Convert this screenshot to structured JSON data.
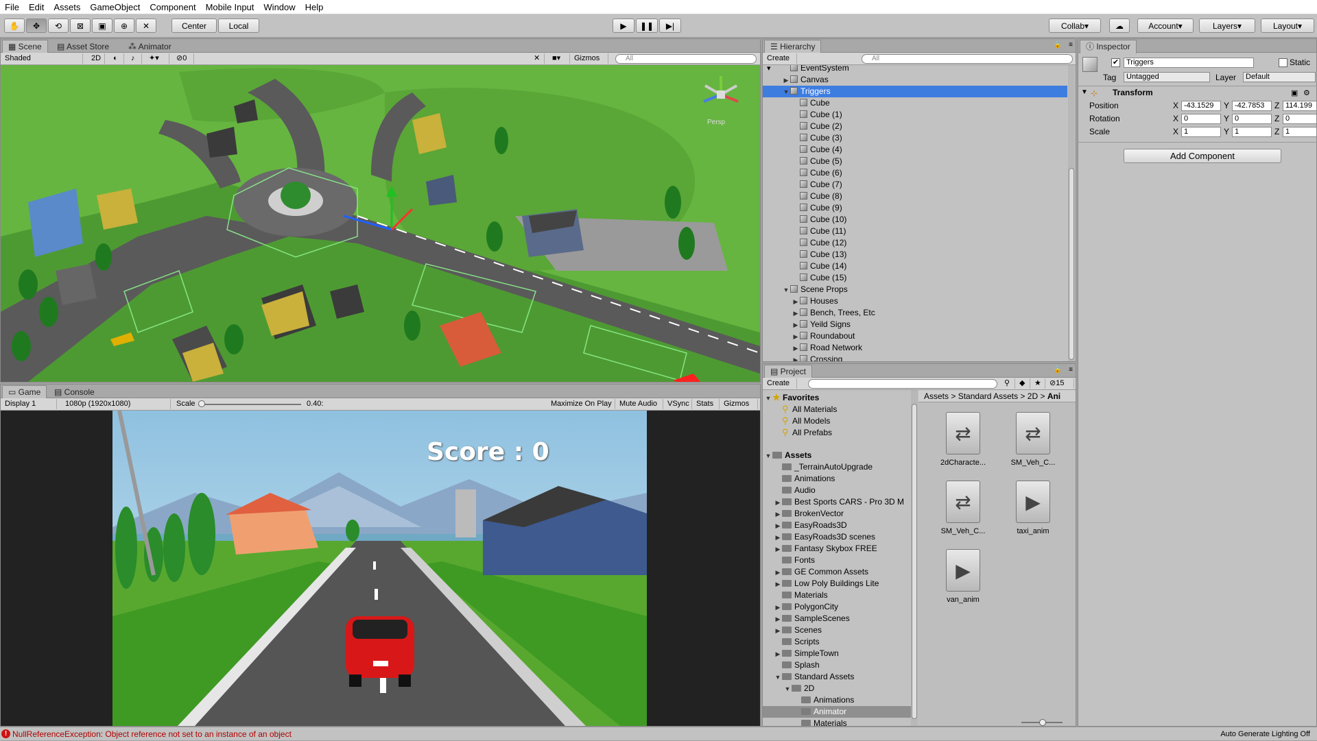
{
  "menu": [
    "File",
    "Edit",
    "Assets",
    "GameObject",
    "Component",
    "Mobile Input",
    "Window",
    "Help"
  ],
  "toolbar": {
    "center": "Center",
    "local": "Local",
    "collab": "Collab",
    "account": "Account",
    "layers": "Layers",
    "layout": "Layout"
  },
  "scene": {
    "tabs": [
      "Scene",
      "Asset Store",
      "Animator"
    ],
    "shading": "Shaded",
    "mode2d": "2D",
    "layers_count": "0",
    "gizmos": "Gizmos",
    "search": "All",
    "persp": "Persp"
  },
  "game": {
    "tabs": [
      "Game",
      "Console"
    ],
    "display": "Display 1",
    "resolution": "1080p (1920x1080)",
    "scale_label": "Scale",
    "scale_value": "0.40:",
    "options": [
      "Maximize On Play",
      "Mute Audio",
      "VSync",
      "Stats",
      "Gizmos"
    ],
    "score": "Score : 0"
  },
  "hierarchy": {
    "title": "Hierarchy",
    "create": "Create",
    "search": "All",
    "rows": [
      {
        "label": "EventSystem",
        "indent": 0,
        "arrow": "",
        "icon": "cube"
      },
      {
        "label": "Canvas",
        "indent": 0,
        "arrow": "▶",
        "icon": "cube"
      },
      {
        "label": "Triggers",
        "indent": 0,
        "arrow": "▼",
        "icon": "cube",
        "selected": true
      },
      {
        "label": "Cube",
        "indent": 1,
        "arrow": "",
        "icon": "cube"
      },
      {
        "label": "Cube (1)",
        "indent": 1,
        "arrow": "",
        "icon": "cube"
      },
      {
        "label": "Cube (2)",
        "indent": 1,
        "arrow": "",
        "icon": "cube"
      },
      {
        "label": "Cube (3)",
        "indent": 1,
        "arrow": "",
        "icon": "cube"
      },
      {
        "label": "Cube (4)",
        "indent": 1,
        "arrow": "",
        "icon": "cube"
      },
      {
        "label": "Cube (5)",
        "indent": 1,
        "arrow": "",
        "icon": "cube"
      },
      {
        "label": "Cube (6)",
        "indent": 1,
        "arrow": "",
        "icon": "cube"
      },
      {
        "label": "Cube (7)",
        "indent": 1,
        "arrow": "",
        "icon": "cube"
      },
      {
        "label": "Cube (8)",
        "indent": 1,
        "arrow": "",
        "icon": "cube"
      },
      {
        "label": "Cube (9)",
        "indent": 1,
        "arrow": "",
        "icon": "cube"
      },
      {
        "label": "Cube (10)",
        "indent": 1,
        "arrow": "",
        "icon": "cube"
      },
      {
        "label": "Cube (11)",
        "indent": 1,
        "arrow": "",
        "icon": "cube"
      },
      {
        "label": "Cube (12)",
        "indent": 1,
        "arrow": "",
        "icon": "cube"
      },
      {
        "label": "Cube (13)",
        "indent": 1,
        "arrow": "",
        "icon": "cube"
      },
      {
        "label": "Cube (14)",
        "indent": 1,
        "arrow": "",
        "icon": "cube"
      },
      {
        "label": "Cube (15)",
        "indent": 1,
        "arrow": "",
        "icon": "cube"
      },
      {
        "label": "Scene Props",
        "indent": 0,
        "arrow": "▼",
        "icon": "cube"
      },
      {
        "label": "Houses",
        "indent": 1,
        "arrow": "▶",
        "icon": "cube"
      },
      {
        "label": "Bench, Trees, Etc",
        "indent": 1,
        "arrow": "▶",
        "icon": "cube"
      },
      {
        "label": "Yeild Signs",
        "indent": 1,
        "arrow": "▶",
        "icon": "cube"
      },
      {
        "label": "Roundabout",
        "indent": 1,
        "arrow": "▶",
        "icon": "cube"
      },
      {
        "label": "Road Network",
        "indent": 1,
        "arrow": "▶",
        "icon": "cube"
      },
      {
        "label": "Crossing",
        "indent": 1,
        "arrow": "▶",
        "icon": "cube"
      }
    ]
  },
  "project": {
    "title": "Project",
    "create": "Create",
    "count": "15",
    "breadcrumb": [
      "Assets",
      "Standard Assets",
      "2D",
      "Ani"
    ],
    "tree": [
      {
        "label": "Favorites",
        "indent": 0,
        "arrow": "▼",
        "icon": "star",
        "bold": true
      },
      {
        "label": "All Materials",
        "indent": 1,
        "arrow": "",
        "icon": "search"
      },
      {
        "label": "All Models",
        "indent": 1,
        "arrow": "",
        "icon": "search"
      },
      {
        "label": "All Prefabs",
        "indent": 1,
        "arrow": "",
        "icon": "search"
      },
      {
        "label": "",
        "indent": 0,
        "arrow": "",
        "icon": ""
      },
      {
        "label": "Assets",
        "indent": 0,
        "arrow": "▼",
        "icon": "folder",
        "bold": true
      },
      {
        "label": "_TerrainAutoUpgrade",
        "indent": 1,
        "arrow": "",
        "icon": "folder"
      },
      {
        "label": "Animations",
        "indent": 1,
        "arrow": "",
        "icon": "folder"
      },
      {
        "label": "Audio",
        "indent": 1,
        "arrow": "",
        "icon": "folder"
      },
      {
        "label": "Best Sports CARS - Pro 3D M",
        "indent": 1,
        "arrow": "▶",
        "icon": "folder"
      },
      {
        "label": "BrokenVector",
        "indent": 1,
        "arrow": "▶",
        "icon": "folder"
      },
      {
        "label": "EasyRoads3D",
        "indent": 1,
        "arrow": "▶",
        "icon": "folder"
      },
      {
        "label": "EasyRoads3D scenes",
        "indent": 1,
        "arrow": "▶",
        "icon": "folder"
      },
      {
        "label": "Fantasy Skybox FREE",
        "indent": 1,
        "arrow": "▶",
        "icon": "folder"
      },
      {
        "label": "Fonts",
        "indent": 1,
        "arrow": "",
        "icon": "folder"
      },
      {
        "label": "GE Common Assets",
        "indent": 1,
        "arrow": "▶",
        "icon": "folder"
      },
      {
        "label": "Low Poly Buildings Lite",
        "indent": 1,
        "arrow": "▶",
        "icon": "folder"
      },
      {
        "label": "Materials",
        "indent": 1,
        "arrow": "",
        "icon": "folder"
      },
      {
        "label": "PolygonCity",
        "indent": 1,
        "arrow": "▶",
        "icon": "folder"
      },
      {
        "label": "SampleScenes",
        "indent": 1,
        "arrow": "▶",
        "icon": "folder"
      },
      {
        "label": "Scenes",
        "indent": 1,
        "arrow": "▶",
        "icon": "folder"
      },
      {
        "label": "Scripts",
        "indent": 1,
        "arrow": "",
        "icon": "folder"
      },
      {
        "label": "SimpleTown",
        "indent": 1,
        "arrow": "▶",
        "icon": "folder"
      },
      {
        "label": "Splash",
        "indent": 1,
        "arrow": "",
        "icon": "folder"
      },
      {
        "label": "Standard Assets",
        "indent": 1,
        "arrow": "▼",
        "icon": "folder"
      },
      {
        "label": "2D",
        "indent": 2,
        "arrow": "▼",
        "icon": "folder"
      },
      {
        "label": "Animations",
        "indent": 3,
        "arrow": "",
        "icon": "folder"
      },
      {
        "label": "Animator",
        "indent": 3,
        "arrow": "",
        "icon": "folder",
        "selected": true
      },
      {
        "label": "Materials",
        "indent": 3,
        "arrow": "",
        "icon": "folder"
      }
    ],
    "assets": [
      {
        "label": "2dCharacte...",
        "icon": "controller"
      },
      {
        "label": "SM_Veh_C...",
        "icon": "controller"
      },
      {
        "label": "SM_Veh_C...",
        "icon": "controller"
      },
      {
        "label": "taxi_anim",
        "icon": "play"
      },
      {
        "label": "van_anim",
        "icon": "play"
      }
    ]
  },
  "inspector": {
    "title": "Inspector",
    "name": "Triggers",
    "static": "Static",
    "tag_label": "Tag",
    "tag": "Untagged",
    "layer_label": "Layer",
    "layer": "Default",
    "transform": "Transform",
    "position_label": "Position",
    "position": {
      "x": "-43.1529",
      "y": "-42.7853",
      "z": "114.199"
    },
    "rotation_label": "Rotation",
    "rotation": {
      "x": "0",
      "y": "0",
      "z": "0"
    },
    "scale_label": "Scale",
    "scale": {
      "x": "1",
      "y": "1",
      "z": "1"
    },
    "add_component": "Add Component"
  },
  "status": {
    "error": "NullReferenceException: Object reference not set to an instance of an object",
    "lighting": "Auto Generate Lighting Off"
  }
}
